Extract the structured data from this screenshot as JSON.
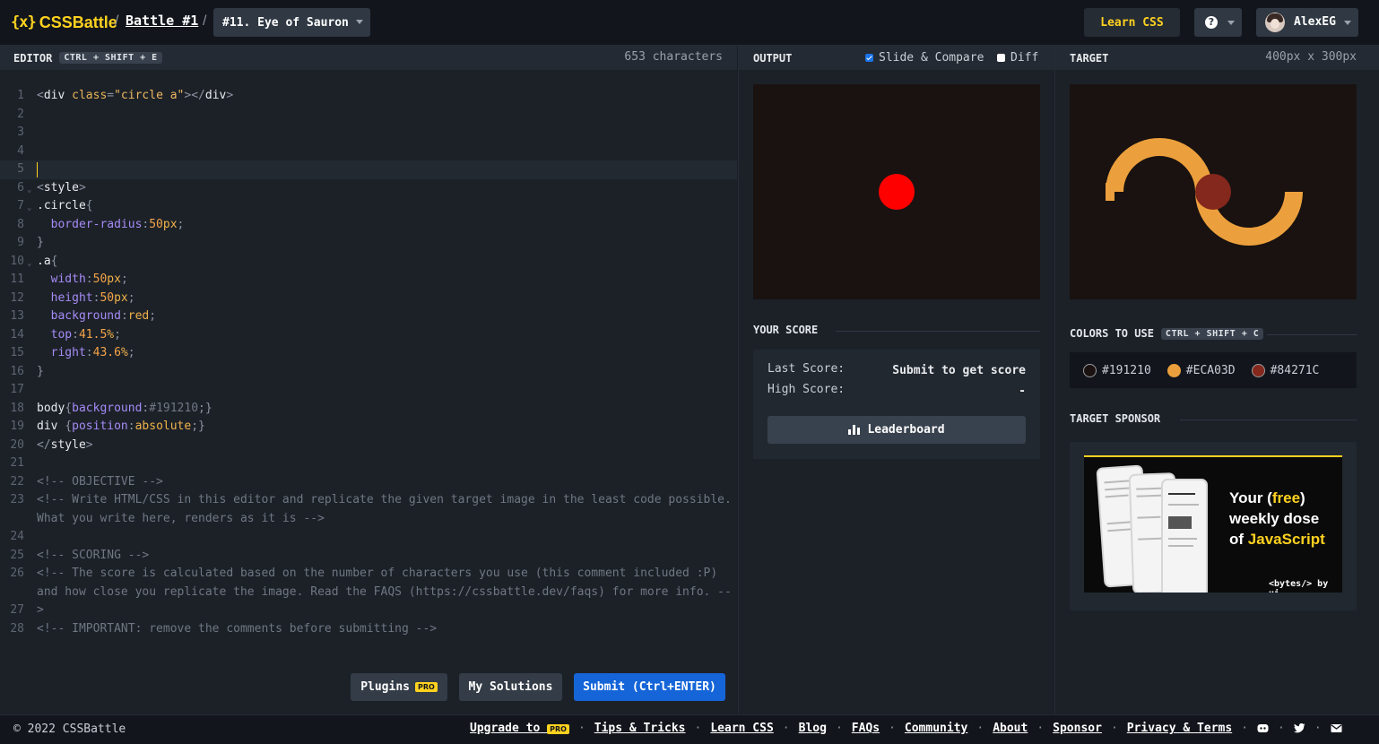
{
  "header": {
    "logo_mark": "{x}",
    "logo_text": "CSSBattle",
    "separator": "/",
    "battle_label": "Battle #1",
    "target_label": "#11. Eye of Sauron",
    "learn_css_label": "Learn CSS",
    "help_glyph": "?",
    "user_name": "AlexEG"
  },
  "editor": {
    "title": "EDITOR",
    "shortcut": "CTRL + SHIFT + E",
    "char_count": "653 characters",
    "lines": [
      {
        "n": "1"
      },
      {
        "n": "2"
      },
      {
        "n": "3"
      },
      {
        "n": "4"
      },
      {
        "n": "5"
      },
      {
        "n": "6"
      },
      {
        "n": "7"
      },
      {
        "n": "8"
      },
      {
        "n": "9"
      },
      {
        "n": "10"
      },
      {
        "n": "11"
      },
      {
        "n": "12"
      },
      {
        "n": "13"
      },
      {
        "n": "14"
      },
      {
        "n": "15"
      },
      {
        "n": "16"
      },
      {
        "n": "17"
      },
      {
        "n": "18"
      },
      {
        "n": "19"
      },
      {
        "n": "20"
      },
      {
        "n": "21"
      },
      {
        "n": "22"
      },
      {
        "n": "23"
      },
      {
        "n": "24"
      },
      {
        "n": "25"
      },
      {
        "n": "26"
      },
      {
        "n": "27"
      },
      {
        "n": "28"
      }
    ],
    "code": {
      "l1": "<div class=\"circle a\"></div>",
      "l6": "<style>",
      "l7": ".circle{",
      "l8": "  border-radius:50px;",
      "l9": "}",
      "l10": ".a{",
      "l11": "  width:50px;",
      "l12": "  height:50px;",
      "l13": "  background:red;",
      "l14": "  top:41.5%;",
      "l15": "  right:43.6%;",
      "l16": "}",
      "l18": "body{background:#191210;}",
      "l19": "div {position:absolute;}",
      "l20": "</style>",
      "l22": "<!-- OBJECTIVE -->",
      "l23": "<!-- Write HTML/CSS in this editor and replicate the given target image in the least code possible. What you write here, renders as it is -->",
      "l25": "<!-- SCORING -->",
      "l26": "<!-- The score is calculated based on the number of characters you use (this comment included :P) and how close you replicate the image. Read the FAQS (https://cssbattle.dev/faqs) for more info. -->",
      "l28": "<!-- IMPORTANT: remove the comments before submitting -->"
    },
    "buttons": {
      "plugins": "Plugins",
      "pro": "PRO",
      "solutions": "My Solutions",
      "submit": "Submit (Ctrl+ENTER)"
    }
  },
  "output": {
    "title": "OUTPUT",
    "slide_compare": "Slide & Compare",
    "slide_compare_checked": true,
    "diff": "Diff",
    "diff_checked": false,
    "score_title": "YOUR SCORE",
    "last_score_label": "Last Score:",
    "last_score_value": "Submit to get score",
    "high_score_label": "High Score:",
    "high_score_value": "-",
    "leaderboard_label": "Leaderboard"
  },
  "target": {
    "title": "TARGET",
    "dims": "400px x 300px",
    "colors_title": "COLORS TO USE",
    "colors_shortcut": "CTRL + SHIFT + C",
    "colors": [
      {
        "hex": "#191210",
        "label": "#191210"
      },
      {
        "hex": "#ECA03D",
        "label": "#ECA03D"
      },
      {
        "hex": "#84271C",
        "label": "#84271C"
      }
    ],
    "sponsor_title": "TARGET SPONSOR",
    "ad": {
      "line1_a": "Your (",
      "line1_b": "free",
      "line1_c": ")",
      "line2": "weekly dose",
      "line3_a": "of ",
      "line3_b": "JavaScript",
      "brand": "<bytes/> by ui"
    }
  },
  "footer": {
    "copyright": "© 2022 CSSBattle",
    "links": [
      "Upgrade to",
      "Tips & Tricks",
      "Learn CSS",
      "Blog",
      "FAQs",
      "Community",
      "About",
      "Sponsor",
      "Privacy & Terms"
    ],
    "pro": "PRO",
    "dot": "·"
  }
}
